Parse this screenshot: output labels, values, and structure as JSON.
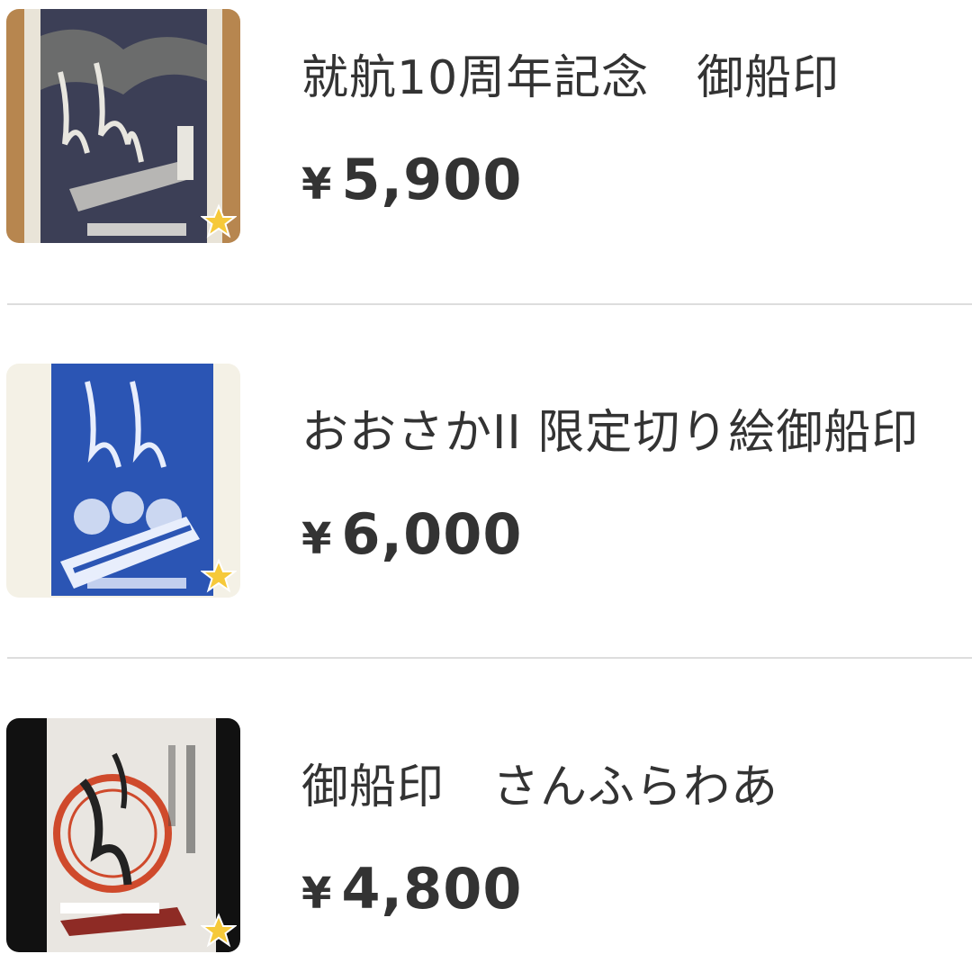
{
  "items": [
    {
      "title": "就航10周年記念　御船印",
      "currency": "¥",
      "price": "5,900",
      "thumb_icon": "ferry-stamp-image",
      "badge_icon": "star-icon"
    },
    {
      "title": "おおさかII 限定切り絵御船印",
      "currency": "¥",
      "price": "6,000",
      "thumb_icon": "ferry-stamp-image",
      "badge_icon": "star-icon"
    },
    {
      "title": "御船印　さんふらわあ",
      "currency": "¥",
      "price": "4,800",
      "thumb_icon": "ferry-stamp-image",
      "badge_icon": "star-icon"
    }
  ]
}
